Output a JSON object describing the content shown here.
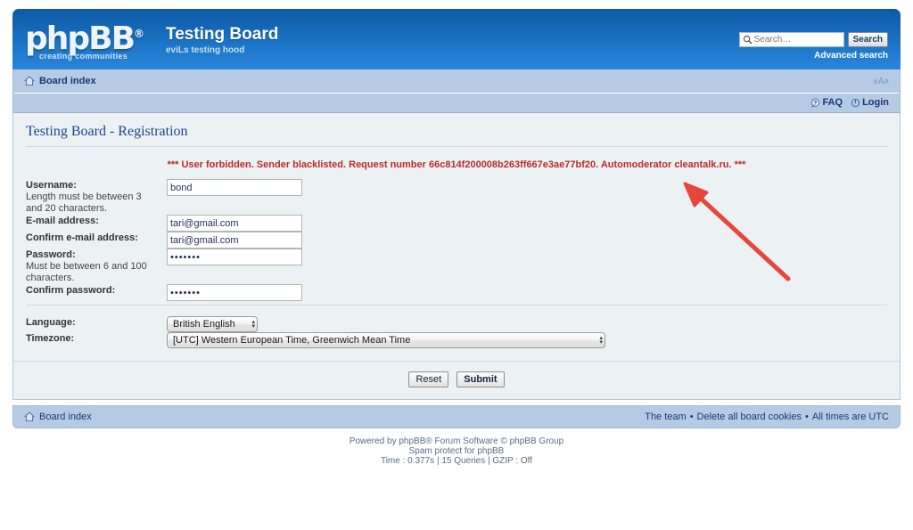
{
  "header": {
    "logo_text": "phpBB",
    "logo_reg": "®",
    "logo_tagline": "creating communities",
    "board_title": "Testing Board",
    "board_subtitle": "eviLs testing hood",
    "search": {
      "placeholder": "Search…",
      "value": "",
      "icon": "search-icon",
      "button_label": "Search",
      "advanced_label": "Advanced search"
    }
  },
  "nav": {
    "board_index_label": "Board index",
    "home_icon": "house-icon",
    "fontsize_control": "∨A∧",
    "faq_label": "FAQ",
    "faq_icon": "question-bubble-icon",
    "login_label": "Login",
    "login_icon": "power-icon"
  },
  "main": {
    "page_title": "Testing Board - Registration",
    "error_message": "*** User forbidden. Sender blacklisted. Request number 66c814f200008b263ff667e3ae77bf20. Automoderator cleantalk.ru. ***",
    "fields": [
      {
        "label": "Username:",
        "description": "Length must be between 3 and 20 characters.",
        "value": "bond",
        "type": "text",
        "name": "username-field"
      },
      {
        "label": "E-mail address:",
        "description": "",
        "value": "tari@gmail.com",
        "type": "text",
        "name": "email-field"
      },
      {
        "label": "Confirm e-mail address:",
        "description": "",
        "value": "tari@gmail.com",
        "type": "text",
        "name": "confirm-email-field"
      },
      {
        "label": "Password:",
        "description": "Must be between 6 and 100 characters.",
        "value": "•••••••",
        "type": "password",
        "name": "password-field"
      },
      {
        "label": "Confirm password:",
        "description": "",
        "value": "•••••••",
        "type": "password",
        "name": "confirm-password-field"
      }
    ],
    "language": {
      "label": "Language:",
      "selected": "British English"
    },
    "timezone": {
      "label": "Timezone:",
      "selected": "[UTC] Western European Time, Greenwich Mean Time"
    },
    "buttons": {
      "reset_label": "Reset",
      "submit_label": "Submit"
    }
  },
  "footer": {
    "board_index_label": "Board index",
    "home_icon": "house-icon",
    "team_label": "The team",
    "cookies_label": "Delete all board cookies",
    "times_label": "All times are UTC",
    "separator": "•",
    "credits_line1_a": "Powered by ",
    "credits_line1_b": "phpBB",
    "credits_line1_c": "® Forum Software © phpBB Group",
    "credits_line2": "Spam protect for phpBB",
    "credits_line3": "Time : 0.377s | 15 Queries | GZIP : Off"
  },
  "annotation": {
    "arrow_color": "#e8453c",
    "arrow_name": "red-pointer-arrow"
  },
  "colors": {
    "header_blue_dark": "#0d5ba6",
    "header_blue_light": "#2a86dc",
    "nav_blue": "#b6cbe3",
    "panel_bg": "#ecf1f4",
    "error_red": "#bc2a2a",
    "link_navy": "#16387a",
    "title_blue": "#18478f"
  }
}
